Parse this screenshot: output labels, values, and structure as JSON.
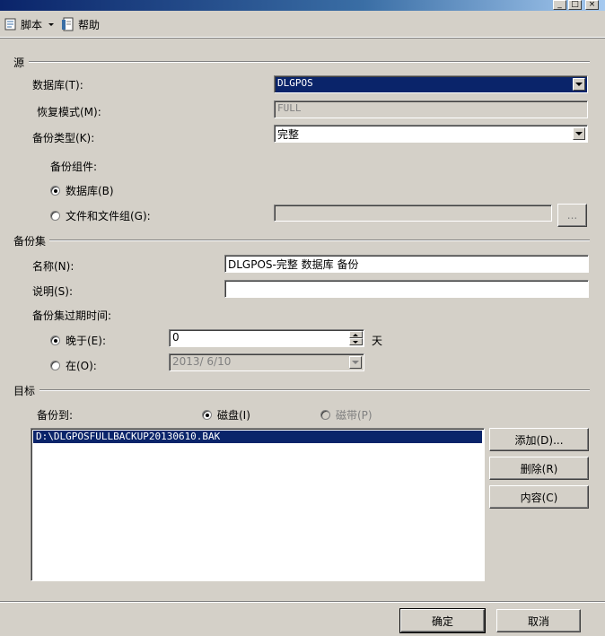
{
  "window": {
    "minimize": "_",
    "maximize": "□",
    "close": "×"
  },
  "toolbar": {
    "script_label": "脚本",
    "help_label": "帮助"
  },
  "source": {
    "section": "源",
    "database_label": "数据库(T):",
    "database_value": "DLGPOS",
    "recovery_label": "恢复模式(M):",
    "recovery_value": "FULL",
    "backup_type_label": "备份类型(K):",
    "backup_type_value": "完整",
    "component_label": "备份组件:",
    "component_db_label": "数据库(B)",
    "component_files_label": "文件和文件组(G):",
    "browse_label": "..."
  },
  "backup_set": {
    "section": "备份集",
    "name_label": "名称(N):",
    "name_value": "DLGPOS-完整 数据库 备份",
    "desc_label": "说明(S):",
    "desc_value": "",
    "expire_label": "备份集过期时间:",
    "after_label": "晚于(E):",
    "after_value": "0",
    "after_unit": "天",
    "on_label": "在(O):",
    "on_value": "2013/ 6/10"
  },
  "destination": {
    "section": "目标",
    "backup_to_label": "备份到:",
    "disk_label": "磁盘(I)",
    "tape_label": "磁带(P)",
    "items": [
      "D:\\DLGPOSFULLBACKUP20130610.BAK"
    ],
    "add_label": "添加(D)...",
    "remove_label": "删除(R)",
    "contents_label": "内容(C)"
  },
  "footer": {
    "ok_label": "确定",
    "cancel_label": "取消"
  },
  "colors": {
    "face": "#d4d0c8",
    "selection": "#0a246a"
  }
}
